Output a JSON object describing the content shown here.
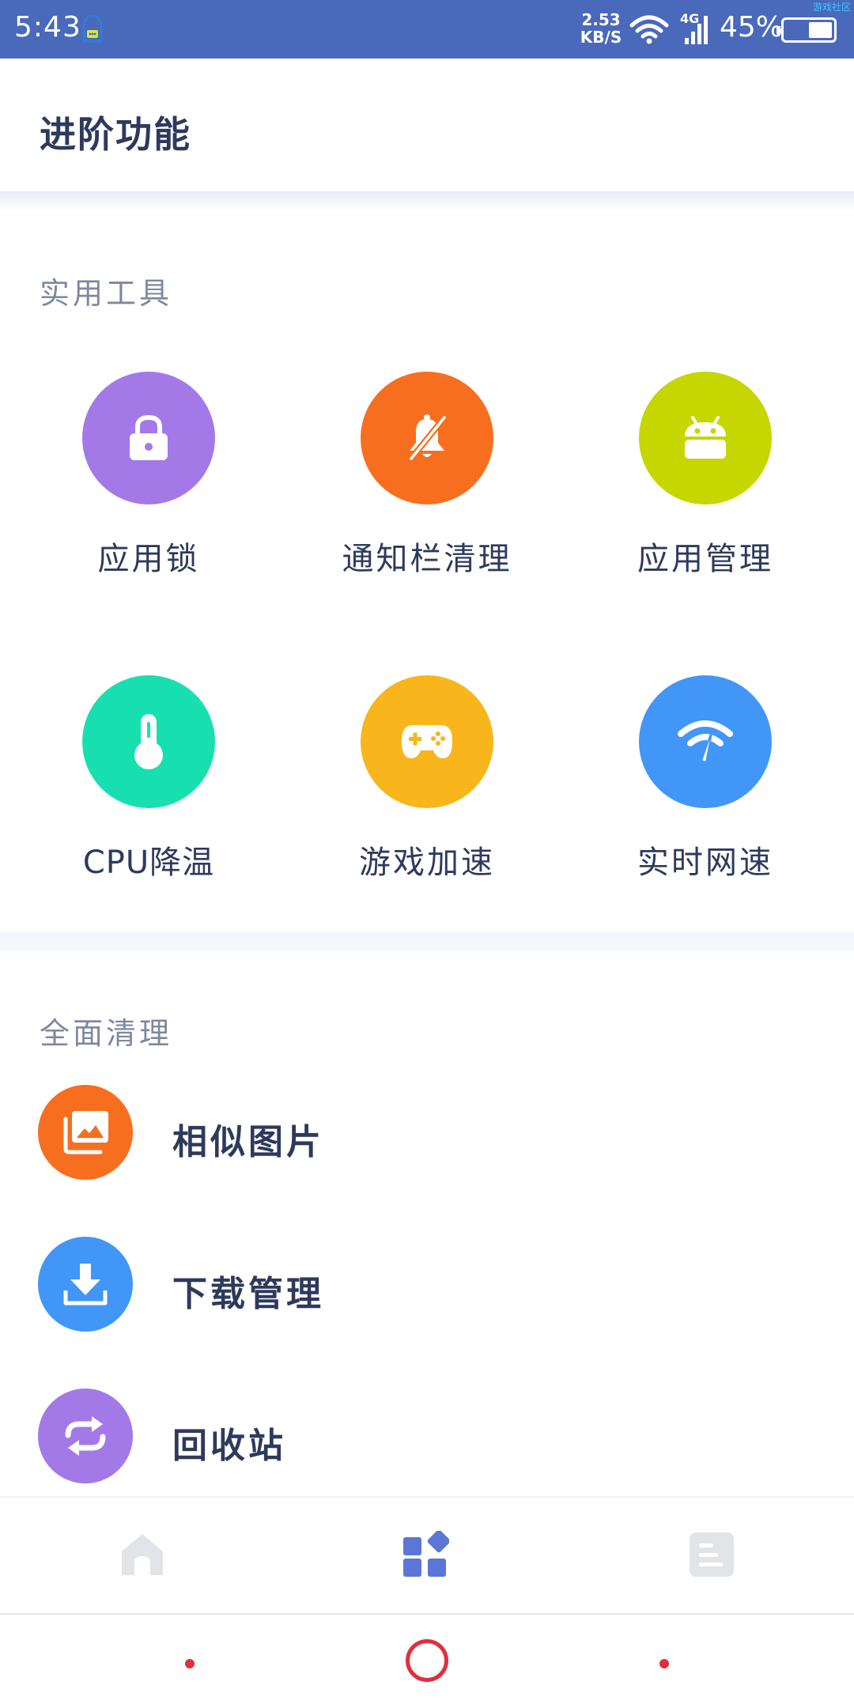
{
  "status_bar": {
    "time": "5:43",
    "net_speed_value": "2.53",
    "net_speed_unit": "KB/S",
    "network_type": "4G",
    "battery_percent": "45%",
    "battery_level": 0.45,
    "watermark": "游戏社区",
    "color": "#4a69bb"
  },
  "header": {
    "title": "进阶功能"
  },
  "tools_section": {
    "title": "实用工具",
    "items": [
      {
        "label": "应用锁",
        "icon": "lock-icon",
        "color": "#a379e8"
      },
      {
        "label": "通知栏清理",
        "icon": "bell-off-icon",
        "color": "#f76e1f"
      },
      {
        "label": "应用管理",
        "icon": "android-icon",
        "color": "#c5d600"
      },
      {
        "label": "CPU降温",
        "icon": "thermometer-icon",
        "color": "#18dfb0"
      },
      {
        "label": "游戏加速",
        "icon": "gamepad-icon",
        "color": "#f8b51c"
      },
      {
        "label": "实时网速",
        "icon": "wifi-speed-icon",
        "color": "#4296f7"
      }
    ]
  },
  "clean_section": {
    "title": "全面清理",
    "items": [
      {
        "label": "相似图片",
        "icon": "gallery-icon",
        "color": "#f76e1f"
      },
      {
        "label": "下载管理",
        "icon": "download-icon",
        "color": "#4296f7"
      },
      {
        "label": "回收站",
        "icon": "recycle-icon",
        "color": "#a379e8"
      }
    ]
  },
  "tab_bar": {
    "items": [
      {
        "icon": "home-icon",
        "active": false
      },
      {
        "icon": "features-grid-icon",
        "active": true
      },
      {
        "icon": "list-icon",
        "active": false
      }
    ],
    "active_color": "#5b76d6",
    "inactive_color": "#e3e4e8"
  }
}
